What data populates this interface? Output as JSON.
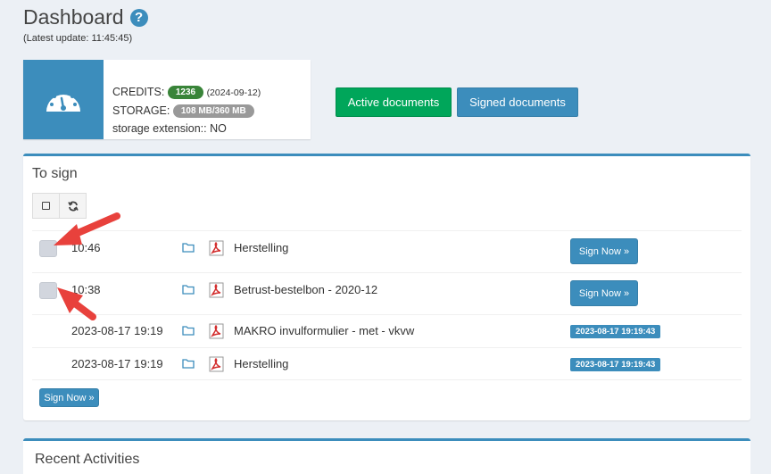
{
  "header": {
    "title": "Dashboard",
    "help_icon": "?",
    "last_update": "(Latest update: 11:45:45)"
  },
  "info": {
    "icon": "dashboard-gauge-icon",
    "credits_label": "CREDITS:",
    "credits_value": "1236",
    "credits_date": "(2024-09-12)",
    "storage_label": "STORAGE:",
    "storage_value": "108 MB/360 MB",
    "extension_text": "storage extension:: NO"
  },
  "buttons": {
    "active_documents": "Active documents",
    "signed_documents": "Signed documents"
  },
  "to_sign": {
    "title": "To sign",
    "rows": [
      {
        "time": "10:46",
        "name": "Herstelling",
        "action": "Sign Now »"
      },
      {
        "time": "10:38",
        "name": "Betrust-bestelbon - 2020-12",
        "action": "Sign Now »"
      },
      {
        "time": "2023-08-17 19:19",
        "name": "MAKRO invulformulier - met - vkvw",
        "signed_at": "2023-08-17 19:19:43"
      },
      {
        "time": "2023-08-17 19:19",
        "name": "Herstelling",
        "signed_at": "2023-08-17 19:19:43"
      }
    ],
    "bottom_action": "Sign Now »"
  },
  "recent": {
    "title": "Recent Activities"
  },
  "colors": {
    "primary": "#3c8dbc",
    "success": "#00a65a",
    "annotation_arrow": "#e8413c"
  }
}
